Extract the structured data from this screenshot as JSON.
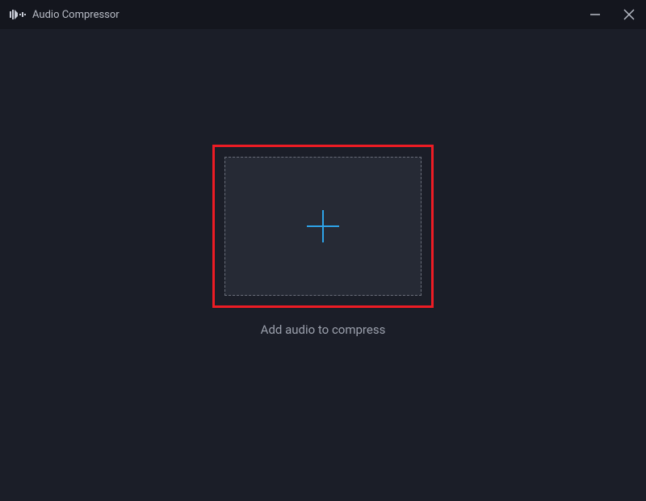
{
  "titlebar": {
    "app_title": "Audio Compressor"
  },
  "main": {
    "instruction": "Add audio to compress"
  },
  "icons": {
    "app": "audio-compressor-icon",
    "minimize": "minimize-icon",
    "close": "close-icon",
    "plus": "plus-icon"
  },
  "colors": {
    "background": "#1b1e28",
    "titlebar": "#14161e",
    "dropzone": "#262a35",
    "border_dashed": "#6a6e7a",
    "highlight": "#ed1c24",
    "accent": "#2ea3e8",
    "text_primary": "#b8bcc6",
    "text_secondary": "#9ba0ac"
  }
}
